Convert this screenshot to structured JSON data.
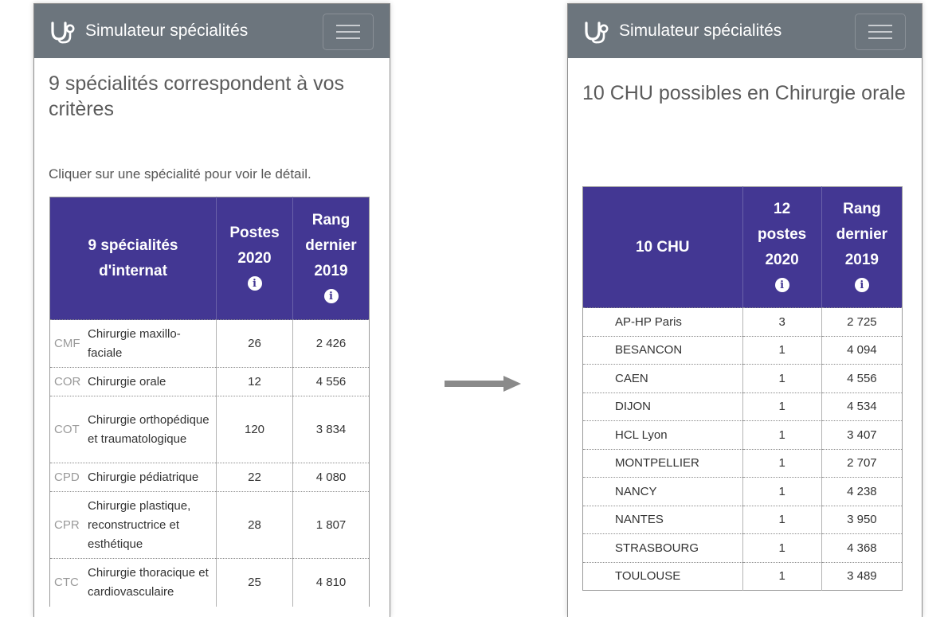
{
  "app": {
    "brand": "Simulateur spécialités",
    "brand_icon": "stethoscope-icon",
    "menu_icon": "hamburger-menu-icon"
  },
  "colors": {
    "navbar": "#6c757d",
    "table_header": "#433793"
  },
  "left_screen": {
    "title": "9 spécialités correspondent à vos critères",
    "subtitle": "Cliquer sur une spécialité pour voir le détail.",
    "headers": {
      "col1": "9 spécialités d'internat",
      "col2": "Postes 2020",
      "col3": "Rang dernier 2019"
    },
    "rows": [
      {
        "code": "CMF",
        "name": "Chirurgie maxillo-faciale",
        "postes": "26",
        "rang": "2 426"
      },
      {
        "code": "COR",
        "name": "Chirurgie orale",
        "postes": "12",
        "rang": "4 556"
      },
      {
        "code": "COT",
        "name": "Chirurgie orthopédique et traumatologique",
        "postes": "120",
        "rang": "3 834"
      },
      {
        "code": "CPD",
        "name": "Chirurgie pédiatrique",
        "postes": "22",
        "rang": "4 080"
      },
      {
        "code": "CPR",
        "name": "Chirurgie plastique, reconstructrice et esthétique",
        "postes": "28",
        "rang": "1 807"
      },
      {
        "code": "CTC",
        "name": "Chirurgie thoracique et cardiovasculaire",
        "postes": "25",
        "rang": "4 810"
      }
    ]
  },
  "right_screen": {
    "title": "10 CHU possibles en Chirurgie orale",
    "headers": {
      "col1": "10 CHU",
      "col2": "12 postes 2020",
      "col3": "Rang dernier 2019"
    },
    "rows": [
      {
        "chu": "AP-HP Paris",
        "postes": "3",
        "rang": "2 725"
      },
      {
        "chu": "BESANCON",
        "postes": "1",
        "rang": "4 094"
      },
      {
        "chu": "CAEN",
        "postes": "1",
        "rang": "4 556"
      },
      {
        "chu": "DIJON",
        "postes": "1",
        "rang": "4 534"
      },
      {
        "chu": "HCL Lyon",
        "postes": "1",
        "rang": "3 407"
      },
      {
        "chu": "MONTPELLIER",
        "postes": "1",
        "rang": "2 707"
      },
      {
        "chu": "NANCY",
        "postes": "1",
        "rang": "4 238"
      },
      {
        "chu": "NANTES",
        "postes": "1",
        "rang": "3 950"
      },
      {
        "chu": "STRASBOURG",
        "postes": "1",
        "rang": "4 368"
      },
      {
        "chu": "TOULOUSE",
        "postes": "1",
        "rang": "3 489"
      }
    ]
  },
  "info_glyph": "i"
}
